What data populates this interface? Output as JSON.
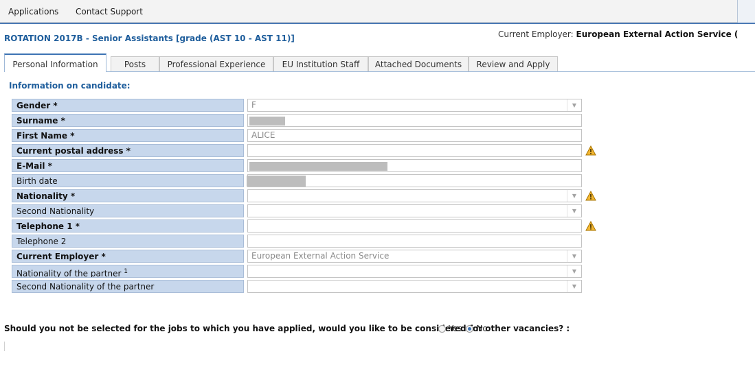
{
  "menubar": {
    "items": [
      "Applications",
      "Contact Support"
    ]
  },
  "header": {
    "campaign_title": "ROTATION 2017B - Senior Assistants [grade (AST 10 - AST 11)]",
    "employer_label": "Current Employer:",
    "employer_value": "European External Action Service ("
  },
  "tabs": [
    {
      "label": "Personal Information",
      "active": true
    },
    {
      "label": "Posts",
      "active": false
    },
    {
      "label": "Professional Experience",
      "active": false
    },
    {
      "label": "EU Institution Staff",
      "active": false
    },
    {
      "label": "Attached Documents",
      "active": false
    },
    {
      "label": "Review and Apply",
      "active": false
    }
  ],
  "section": {
    "title": "Information on candidate:"
  },
  "form": {
    "gender": {
      "label": "Gender *",
      "value": "F"
    },
    "surname": {
      "label": "Surname *",
      "value": ""
    },
    "first_name": {
      "label": "First Name *",
      "value": "ALICE"
    },
    "postal_address": {
      "label": "Current postal address *",
      "value": ""
    },
    "email": {
      "label": "E-Mail *",
      "value": ""
    },
    "birth_date": {
      "label": "Birth date",
      "value": ""
    },
    "nationality": {
      "label": "Nationality *",
      "value": ""
    },
    "second_nationality": {
      "label": "Second Nationality",
      "value": ""
    },
    "telephone1": {
      "label": "Telephone 1 *",
      "value": ""
    },
    "telephone2": {
      "label": "Telephone 2",
      "value": ""
    },
    "current_employer": {
      "label": "Current Employer *",
      "value": "European External Action Service"
    },
    "partner_nationality": {
      "label": "Nationality of the partner",
      "footnote": "1",
      "value": ""
    },
    "partner_second_nationality": {
      "label": "Second Nationality of the partner",
      "value": ""
    }
  },
  "question": {
    "text": "Should you not be selected for the jobs to which you have applied, would you like to be considered for other vacancies? :",
    "options": [
      "Yes",
      "No"
    ],
    "selected": "No"
  },
  "icons": {
    "warning": "warning-icon",
    "dropdown": "chevron-down-icon",
    "warning_color": "#f2b632"
  }
}
